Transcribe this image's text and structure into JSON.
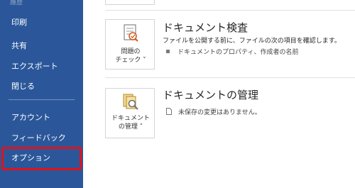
{
  "nav": {
    "partial_top_label": "履歴",
    "items": [
      {
        "label": "印刷"
      },
      {
        "label": "共有"
      },
      {
        "label": "エクスポート"
      },
      {
        "label": "閉じる"
      },
      {
        "label": "アカウント"
      },
      {
        "label": "フィードバック"
      },
      {
        "label": "オプション"
      }
    ],
    "highlight_color": "#e2111b",
    "background_color": "#2b579a"
  },
  "inspect": {
    "card_label_line1": "問題の",
    "card_label_line2": "チェック ˅",
    "title": "ドキュメント検査",
    "description": "ファイルを公開する前に、ファイルの次の項目を確認します。",
    "bullet": "ドキュメントのプロパティ、作成者の名前",
    "icon": "inspect-document-icon"
  },
  "manage": {
    "card_label_line1": "ドキュメント",
    "card_label_line2": "の管理 ˅",
    "title": "ドキュメントの管理",
    "status": "未保存の変更はありません。",
    "icon": "manage-document-icon"
  }
}
